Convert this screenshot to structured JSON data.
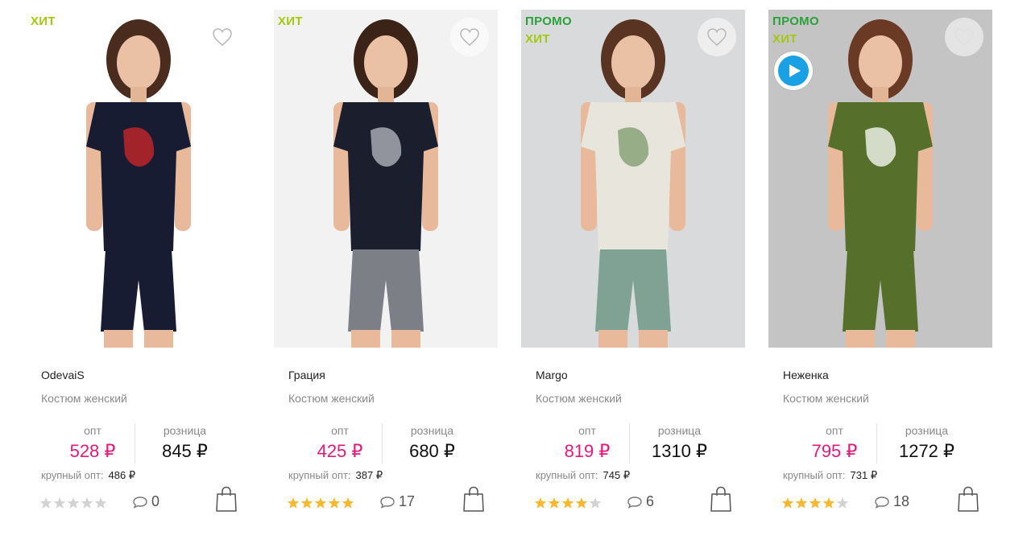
{
  "products": [
    {
      "badges": [
        {
          "text": "ХИТ",
          "kind": "hit"
        }
      ],
      "brand": "OdevaiS",
      "subtitle": "Костюм женский",
      "opt_label": "опт",
      "retail_label": "розница",
      "opt_price": "528 ₽",
      "retail_price": "845 ₽",
      "bulk_label": "крупный опт:",
      "bulk_price": "486 ₽",
      "rating": 0,
      "comments": "0",
      "has_video": false,
      "photo": {
        "bg": "#ffffff",
        "top": "#181c33",
        "bottom": "#181c33",
        "accent": "#d1262a",
        "hair": "#4a2c1f"
      }
    },
    {
      "badges": [
        {
          "text": "ХИТ",
          "kind": "hit"
        }
      ],
      "brand": "Грация",
      "subtitle": "Костюм женский",
      "opt_label": "опт",
      "retail_label": "розница",
      "opt_price": "425 ₽",
      "retail_price": "680 ₽",
      "bulk_label": "крупный опт:",
      "bulk_price": "387 ₽",
      "rating": 5,
      "comments": "17",
      "has_video": false,
      "photo": {
        "bg": "#f2f2f2",
        "top": "#1b1e2c",
        "bottom": "#7d7f86",
        "accent": "#b9bcc2",
        "hair": "#3b2417"
      }
    },
    {
      "badges": [
        {
          "text": "ПРОМО",
          "kind": "promo"
        },
        {
          "text": "ХИТ",
          "kind": "hit"
        }
      ],
      "brand": "Margo",
      "subtitle": "Костюм женский",
      "opt_label": "опт",
      "retail_label": "розница",
      "opt_price": "819 ₽",
      "retail_price": "1310 ₽",
      "bulk_label": "крупный опт:",
      "bulk_price": "745 ₽",
      "rating": 4,
      "comments": "6",
      "has_video": false,
      "photo": {
        "bg": "#d9dadc",
        "top": "#e8e6dc",
        "bottom": "#7fa295",
        "accent": "#7c9a6c",
        "hair": "#5a3422"
      }
    },
    {
      "badges": [
        {
          "text": "ПРОМО",
          "kind": "promo"
        },
        {
          "text": "ХИТ",
          "kind": "hit"
        }
      ],
      "brand": "Неженка",
      "subtitle": "Костюм женский",
      "opt_label": "опт",
      "retail_label": "розница",
      "opt_price": "795 ₽",
      "retail_price": "1272 ₽",
      "bulk_label": "крупный опт:",
      "bulk_price": "731 ₽",
      "rating": 4,
      "comments": "18",
      "has_video": true,
      "photo": {
        "bg": "#c4c4c4",
        "top": "#56702b",
        "bottom": "#56702b",
        "accent": "#ffffff",
        "hair": "#6b3a24"
      }
    }
  ],
  "colors": {
    "opt_price": "#e6197a",
    "badge_hit": "#a4c812",
    "badge_promo": "#2aa13a",
    "star_on": "#f5b82e",
    "star_off": "#d3d3d3",
    "video": "#1aa0e4"
  },
  "icons": {
    "favorite": "heart-outline-icon",
    "comments": "speech-bubble-icon",
    "cart": "shopping-bag-icon",
    "video": "play-icon",
    "rating": "star-icon"
  }
}
